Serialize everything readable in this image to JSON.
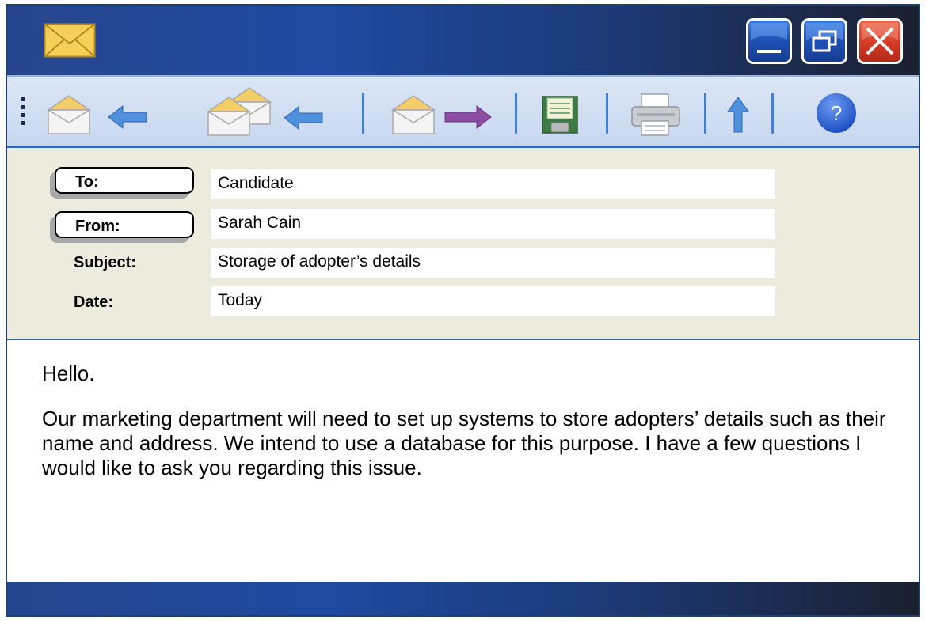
{
  "titlebar": {
    "app_icon": "envelope-icon",
    "buttons": [
      "minimize-icon",
      "restore-icon",
      "close-icon"
    ],
    "close_color": "#d33b25",
    "accent": "#1f4aa0"
  },
  "toolbar": {
    "items": [
      "reply-icon",
      "reply-all-icon",
      "forward-icon",
      "save-icon",
      "print-icon",
      "priority-up-icon",
      "help-icon"
    ],
    "help_label": "?"
  },
  "header": {
    "to_label": "To:",
    "to_value": "Candidate",
    "from_label": "From:",
    "from_value": "Sarah Cain",
    "subject_label": "Subject:",
    "subject_value": "Storage of adopter’s details",
    "date_label": "Date:",
    "date_value": "Today"
  },
  "message": {
    "greeting": "Hello.",
    "paragraph": "Our marketing department will need to set up systems to store adopters’ details such as their name and address. We intend to use a database for this purpose. I have a few questions I would like to ask you regarding this issue."
  }
}
